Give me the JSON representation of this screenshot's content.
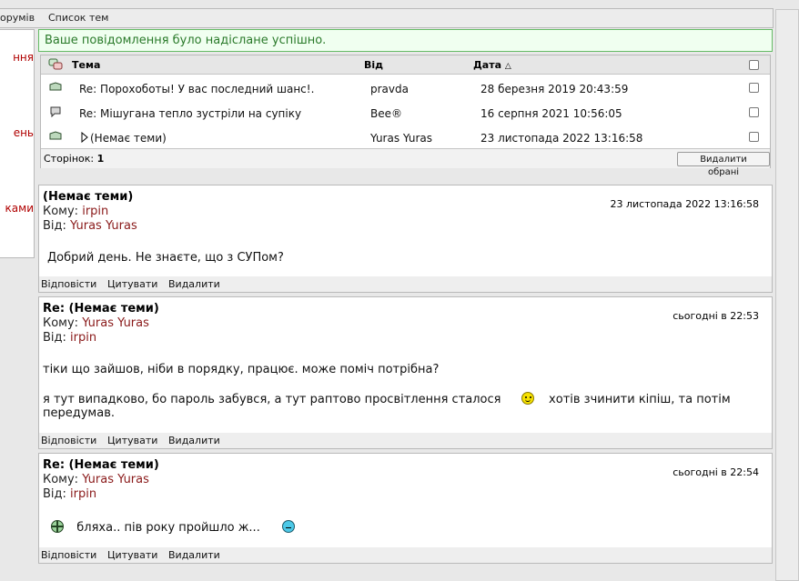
{
  "topnav": {
    "item1": "орумів",
    "item2": "Список тем"
  },
  "sidebar": {
    "items": [
      "ння",
      "ень",
      "ками"
    ]
  },
  "notice": "Ваше повідомлення було надіслане успішно.",
  "list": {
    "columns": {
      "subject": "Тема",
      "from": "Від",
      "date": "Дата"
    },
    "rows": [
      {
        "subject": "Re: Порохоботы! У вас последний шанс!.",
        "from": "pravda",
        "date": "28 березня 2019 20:43:59",
        "icon": "message-icon"
      },
      {
        "subject": "Re: Мішугана тепло зустріли на супіку",
        "from": "Bee®",
        "date": "16 серпня 2021 10:56:05",
        "icon": "speech-icon"
      },
      {
        "subject": "(Немає теми)",
        "from": "Yuras Yuras",
        "date": "23 листопада 2022 13:16:58",
        "icon": "message-icon"
      }
    ],
    "pages_label": "Сторінок:",
    "pages_value": "1",
    "delete_selected": "Видалити обрані"
  },
  "messages": [
    {
      "subject": "(Немає теми)",
      "to_label": "Кому:",
      "to": "irpin",
      "from_label": "Від:",
      "from": "Yuras Yuras",
      "date": "23 листопада 2022 13:16:58",
      "body": [
        "Добрий день. Не знаєте, що з СУПом?"
      ]
    },
    {
      "subject": "Re: (Немає теми)",
      "to_label": "Кому:",
      "to": "Yuras Yuras",
      "from_label": "Від:",
      "from": "irpin",
      "date": "сьогодні в 22:53",
      "body": [
        "тіки що зайшов, ніби в порядку, працює. може поміч потрібна?",
        "я тут випадково, бо пароль забувся, а тут раптово просвітлення сталося",
        "хотів зчинити кіпіш, та потім",
        "передумав."
      ]
    },
    {
      "subject": "Re: (Немає теми)",
      "to_label": "Кому:",
      "to": "Yuras Yuras",
      "from_label": "Від:",
      "from": "irpin",
      "date": "сьогодні в 22:54",
      "body": [
        "бляха.. пів року пройшло ж..."
      ]
    }
  ],
  "actions": {
    "reply": "Відповісти",
    "quote": "Цитувати",
    "delete": "Видалити"
  },
  "colors": {
    "notice_border": "#66bb66",
    "notice_text": "#2a7a2a",
    "user_link": "#8a1a1a",
    "sidebar_link": "#b00000"
  }
}
